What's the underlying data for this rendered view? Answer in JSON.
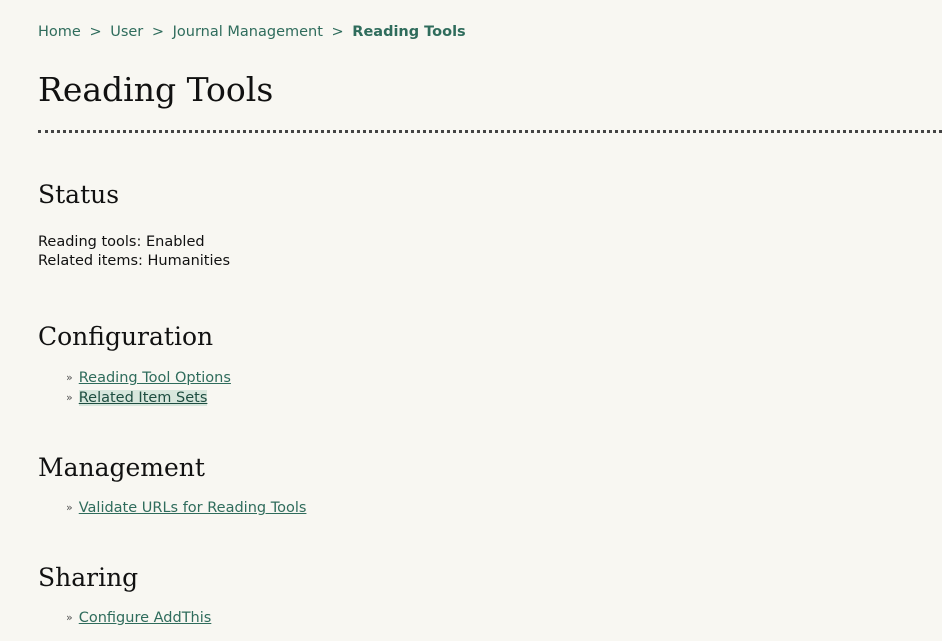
{
  "breadcrumb": {
    "items": [
      "Home",
      "User",
      "Journal Management"
    ],
    "separator": ">",
    "current": "Reading Tools"
  },
  "page_title": "Reading Tools",
  "status": {
    "heading": "Status",
    "reading_tools": "Reading tools: Enabled",
    "related_items": "Related items: Humanities"
  },
  "configuration": {
    "heading": "Configuration",
    "links": [
      "Reading Tool Options",
      "Related Item Sets"
    ]
  },
  "management": {
    "heading": "Management",
    "links": [
      "Validate URLs for Reading Tools"
    ]
  },
  "sharing": {
    "heading": "Sharing",
    "links": [
      "Configure AddThis"
    ]
  },
  "bullet_glyph": "»",
  "colors": {
    "background": "#f8f7f2",
    "link": "#2f6c5c",
    "text": "#111111",
    "highlight": "#d8e7dd"
  }
}
